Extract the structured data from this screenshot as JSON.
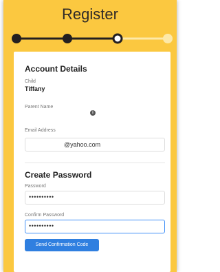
{
  "header": {
    "title": "Register"
  },
  "stepper": {
    "total_steps": 4,
    "current_step": 3,
    "completed_color": "#231f20",
    "pending_color": "#fde9a8",
    "background_color": "#fbc840"
  },
  "account_details": {
    "heading": "Account Details",
    "child_label": "Child",
    "child_value": "Tiffany",
    "parent_name_label": "Parent Name",
    "email_label": "Email Address",
    "email_value": "@yahoo.com"
  },
  "create_password": {
    "heading": "Create Password",
    "password_label": "Password",
    "password_mask": "••••••••••",
    "confirm_label": "Confirm Password",
    "confirm_mask": "••••••••••"
  },
  "actions": {
    "send_code_label": "Send Confirmation Code",
    "button_color": "#2f7fe0"
  },
  "icons": {
    "info": "info-icon"
  }
}
